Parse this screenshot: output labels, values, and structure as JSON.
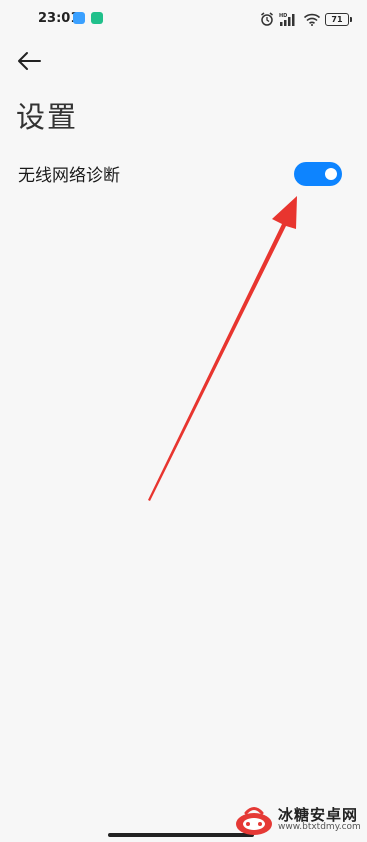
{
  "status_bar": {
    "time": "23:01",
    "battery_level": "71",
    "icons": [
      "cloud-icon",
      "shield-icon",
      "alarm-icon",
      "hd-signal-icon",
      "wifi-icon",
      "battery-icon"
    ]
  },
  "header": {
    "back_icon": "arrow-left-icon",
    "title": "设置"
  },
  "settings": {
    "items": [
      {
        "label": "无线网络诊断",
        "toggle_on": true
      }
    ]
  },
  "colors": {
    "accent": "#0d84ff",
    "background": "#f7f7f7",
    "annotation_arrow": "#e8352f"
  },
  "watermark": {
    "name": "冰糖安卓网",
    "url": "www.btxtdmy.com"
  }
}
